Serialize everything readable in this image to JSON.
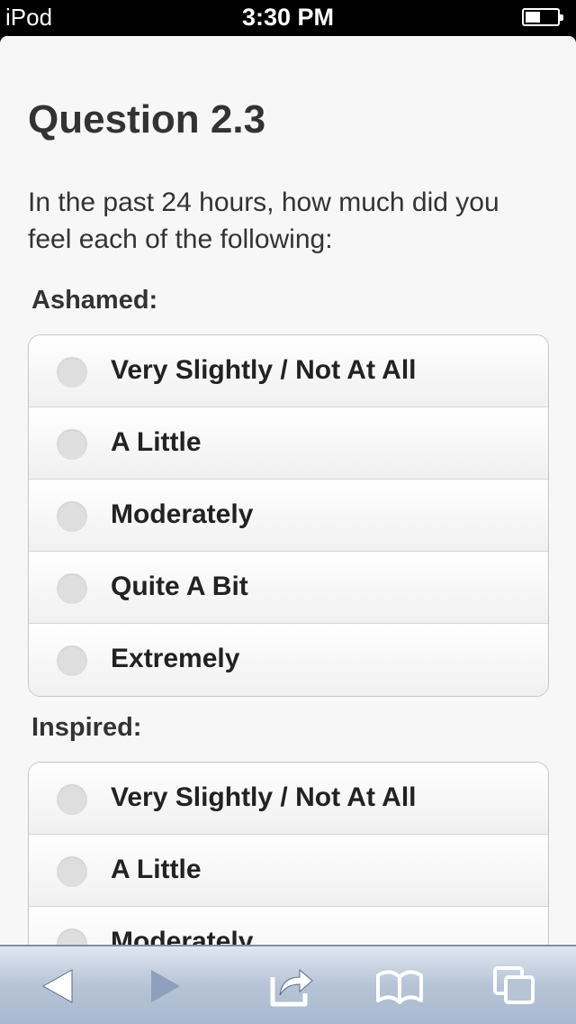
{
  "status_bar": {
    "carrier": "iPod",
    "time": "3:30 PM",
    "battery_level": 0.4
  },
  "question": {
    "title": "Question 2.3",
    "prompt": "In the past 24 hours, how much did you feel each of the following:"
  },
  "groups": [
    {
      "label": "Ashamed:",
      "options": [
        "Very Slightly / Not At All",
        "A Little",
        "Moderately",
        "Quite A Bit",
        "Extremely"
      ]
    },
    {
      "label": "Inspired:",
      "options": [
        "Very Slightly / Not At All",
        "A Little",
        "Moderately"
      ]
    }
  ],
  "toolbar": {
    "icons": [
      "back-arrow-icon",
      "forward-arrow-icon",
      "share-icon",
      "bookmarks-icon",
      "tabs-icon"
    ],
    "colors": {
      "enabled": "#ffffff",
      "disabled": "#8ea0bb"
    }
  }
}
